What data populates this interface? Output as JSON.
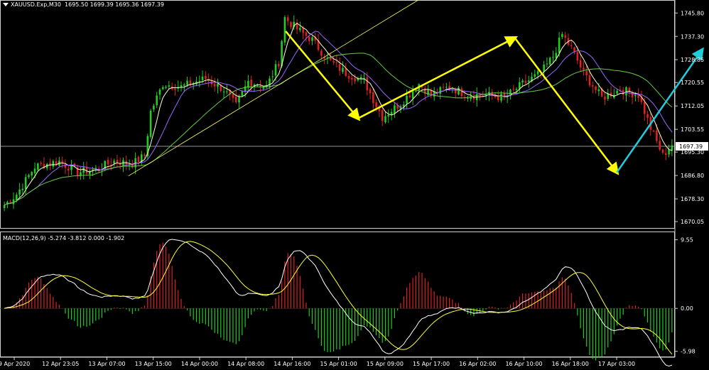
{
  "header": {
    "symbol": "XAUUSD.Exp,M30",
    "ohlc": "1695.50 1699.39 1695.36 1697.39"
  },
  "macd_header": {
    "label": "MACD(12,26,9) -5.274 -3.812 0.000 -1.902"
  },
  "colors": {
    "background": "#000000",
    "bull_candle": "#22cc22",
    "bear_candle": "#dd2222",
    "ma_fast": "#ffffcc",
    "ma_mid": "#9966ff",
    "ma_slow": "#66cc44",
    "annotation_arrow": "#ffff00",
    "forecast_arrow": "#22ccdd",
    "trendline": "#ffff66",
    "macd_line": "#ffffff",
    "signal_line": "#ffff33"
  },
  "chart_data": [
    {
      "type": "candlestick",
      "name": "price",
      "ylim": [
        1668,
        1750
      ],
      "y_ticks": [
        "1745.80",
        "1737.30",
        "1728.85",
        "1720.55",
        "1712.05",
        "1703.55",
        "1695.30",
        "1686.80",
        "1678.30",
        "1670.05"
      ],
      "current_price": "1697.39",
      "x_ticks": [
        "9 Apr 2020",
        "12 Apr 23:05",
        "13 Apr 07:00",
        "13 Apr 15:00",
        "14 Apr 00:00",
        "14 Apr 08:00",
        "14 Apr 16:00",
        "15 Apr 01:00",
        "15 Apr 09:00",
        "15 Apr 17:00",
        "16 Apr 02:00",
        "16 Apr 10:00",
        "16 Apr 18:00",
        "17 Apr 03:00"
      ],
      "anchors": [
        [
          0,
          1676
        ],
        [
          4,
          1680
        ],
        [
          10,
          1690
        ],
        [
          18,
          1692
        ],
        [
          24,
          1688
        ],
        [
          30,
          1689
        ],
        [
          36,
          1692
        ],
        [
          42,
          1691
        ],
        [
          46,
          1694
        ],
        [
          48,
          1710
        ],
        [
          52,
          1720
        ],
        [
          58,
          1719
        ],
        [
          66,
          1722
        ],
        [
          72,
          1718
        ],
        [
          76,
          1712
        ],
        [
          80,
          1721
        ],
        [
          86,
          1719
        ],
        [
          90,
          1728
        ],
        [
          92,
          1744
        ],
        [
          96,
          1740
        ],
        [
          101,
          1736
        ],
        [
          106,
          1729
        ],
        [
          112,
          1724
        ],
        [
          118,
          1721
        ],
        [
          124,
          1708
        ],
        [
          130,
          1713
        ],
        [
          136,
          1720
        ],
        [
          140,
          1716
        ],
        [
          146,
          1719
        ],
        [
          152,
          1716
        ],
        [
          158,
          1716
        ],
        [
          164,
          1715
        ],
        [
          170,
          1720
        ],
        [
          176,
          1724
        ],
        [
          180,
          1730
        ],
        [
          183,
          1738
        ],
        [
          186,
          1733
        ],
        [
          190,
          1724
        ],
        [
          196,
          1715
        ],
        [
          202,
          1718
        ],
        [
          208,
          1716
        ],
        [
          212,
          1704
        ],
        [
          216,
          1694
        ],
        [
          219,
          1698
        ]
      ],
      "series": [
        {
          "name": "",
          "kind": "ma",
          "period": 5
        },
        {
          "name": "",
          "kind": "ma",
          "period": 12
        },
        {
          "name": "",
          "kind": "ma",
          "period": 30
        }
      ],
      "annotations": [
        {
          "kind": "arrow",
          "color": "yellow",
          "from": [
            0.4029,
            0.137
          ],
          "to": [
            0.505,
            0.519
          ]
        },
        {
          "kind": "arrow",
          "color": "yellow",
          "from": [
            0.505,
            0.519
          ],
          "to": [
            0.726,
            0.166
          ]
        },
        {
          "kind": "arrow",
          "color": "yellow",
          "from": [
            0.726,
            0.166
          ],
          "to": [
            0.87,
            0.756
          ]
        },
        {
          "kind": "arrow",
          "color": "cyan",
          "from": [
            0.87,
            0.756
          ],
          "to": [
            0.99,
            0.22
          ]
        },
        {
          "kind": "trendline",
          "color": "yellow",
          "from": [
            0.181,
            0.772
          ],
          "to": [
            0.59,
            0.0
          ]
        }
      ]
    },
    {
      "type": "macd",
      "name": "MACD(12,26,9)",
      "ylim": [
        -6.5,
        10.5
      ],
      "y_ticks": [
        "9.55",
        "0.00",
        "-5.98"
      ],
      "macd": -5.274,
      "signal": -3.812
    }
  ]
}
